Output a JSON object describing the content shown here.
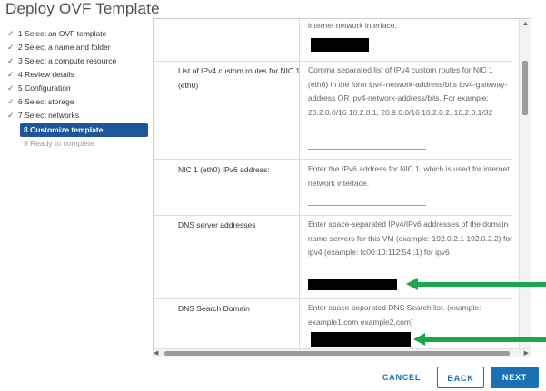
{
  "window": {
    "title": "Deploy OVF Template"
  },
  "steps": [
    {
      "label": "1 Select an OVF template",
      "state": "done"
    },
    {
      "label": "2 Select a name and folder",
      "state": "done"
    },
    {
      "label": "3 Select a compute resource",
      "state": "done"
    },
    {
      "label": "4 Review details",
      "state": "done"
    },
    {
      "label": "5 Configuration",
      "state": "done"
    },
    {
      "label": "6 Select storage",
      "state": "done"
    },
    {
      "label": "7 Select networks",
      "state": "done"
    },
    {
      "label": "8 Customize template",
      "state": "active"
    },
    {
      "label": "9 Ready to complete",
      "state": "pending"
    }
  ],
  "form": {
    "top_fragment": "internet network interface.",
    "rows": [
      {
        "label": "List of IPv4 custom routes for NIC 1 (eth0)",
        "description": "Comma separated list of IPv4 custom routes for NIC 1 (eth0) in the form ipv4-network-address/bits ipv4-gateway-address OR ipv4-network-address/bits. For example: 20.2.0.0/16 10.2.0.1, 20.9.0.0/16 10.2.0.2, 10.2.0.1/32",
        "value": ""
      },
      {
        "label": "NIC 1 (eth0) IPv6 address:",
        "description": "Enter the IPv6 address for NIC 1, which is used for internet network interface.",
        "value": ""
      },
      {
        "label": "DNS server addresses",
        "description": "Enter space-separated IPv4/IPv6 addresses of the domain name servers for this VM (example: 192.0.2.1 192.0.2.2) for ipv4 (example: fc00:10:112:54::1) for ipv6",
        "value": ""
      },
      {
        "label": "DNS Search Domain",
        "description": "Enter space-separated DNS Search list. (example: example1.com example2.com)",
        "value": ""
      }
    ]
  },
  "buttons": {
    "cancel": "CANCEL",
    "back": "BACK",
    "next": "NEXT"
  },
  "colors": {
    "accent": "#1a6fb5",
    "active_step": "#1e5799",
    "check": "#2f8a3a",
    "annotation_arrow": "#1ea64a"
  }
}
